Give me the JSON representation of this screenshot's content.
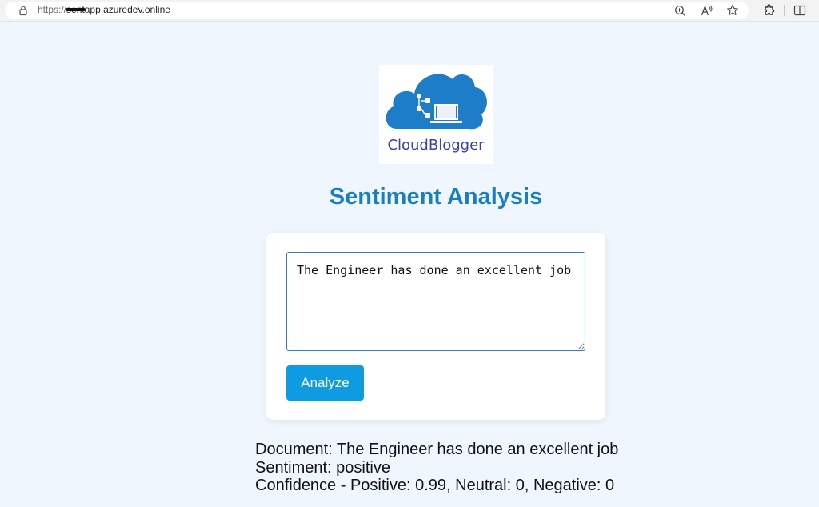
{
  "browser": {
    "url_protocol": "https://",
    "url_redacted": "sent",
    "url_host": "app.azuredev.online",
    "icons": [
      "lock-icon",
      "zoom-icon",
      "read-aloud-icon",
      "favorite-star-icon",
      "extensions-icon",
      "split-screen-icon"
    ]
  },
  "logo": {
    "text": "CloudBlogger",
    "cloud_color": "#1e7dc8"
  },
  "page": {
    "title": "Sentiment Analysis",
    "title_color": "#1a7fc1"
  },
  "form": {
    "input_value": "The Engineer has done an excellent job",
    "analyze_label": "Analyze",
    "button_color": "#0e9be2"
  },
  "results": {
    "document_line": "Document: The Engineer has done an excellent job",
    "sentiment_line": "Sentiment: positive",
    "confidence_line": "Confidence - Positive: 0.99, Neutral: 0, Negative: 0"
  }
}
